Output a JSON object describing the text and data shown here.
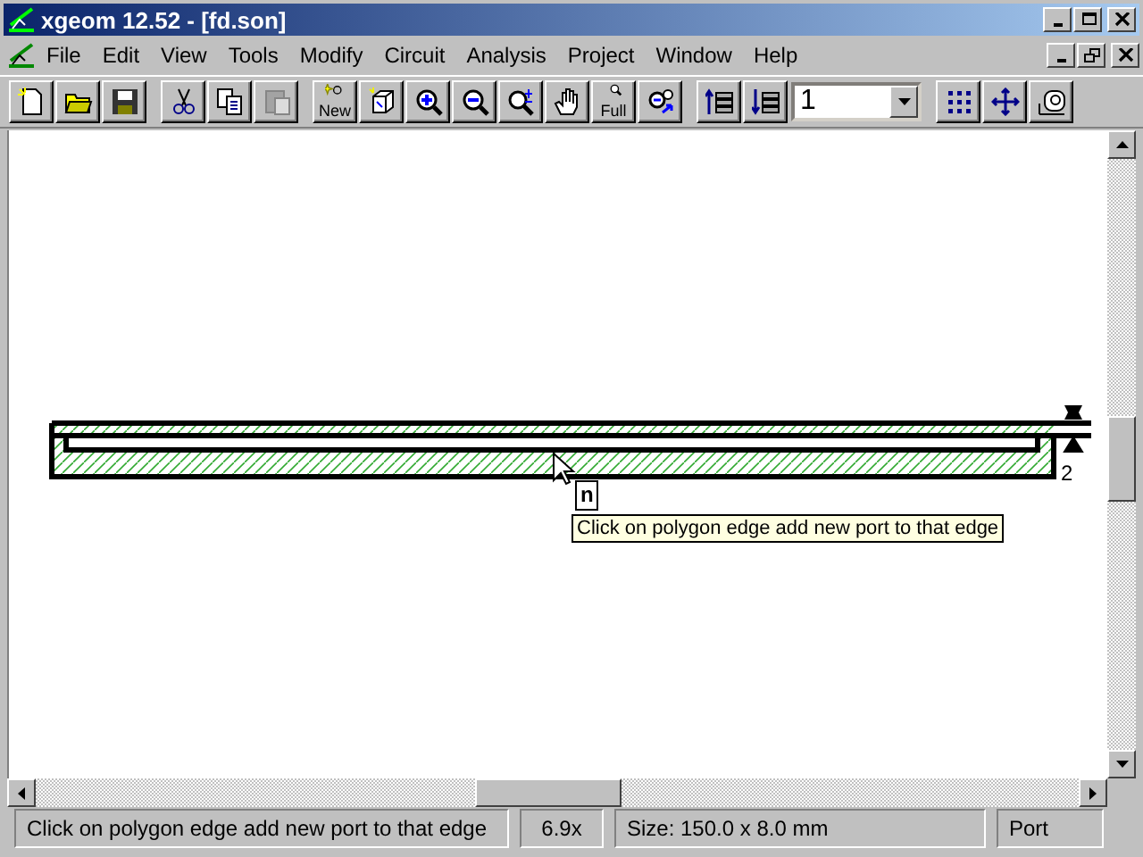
{
  "window": {
    "title": "xgeom 12.52 - [fd.son]"
  },
  "menu": [
    "File",
    "Edit",
    "View",
    "Tools",
    "Modify",
    "Circuit",
    "Analysis",
    "Project",
    "Window",
    "Help"
  ],
  "toolbar": {
    "groups": [
      [
        {
          "disabled": false
        },
        {
          "disabled": false
        },
        {
          "disabled": false
        }
      ],
      [
        {
          "disabled": false
        },
        {
          "disabled": false
        },
        {
          "disabled": true
        }
      ],
      [
        {
          "disabled": false,
          "label": "New"
        },
        {
          "disabled": false
        },
        {
          "disabled": false
        },
        {
          "disabled": false
        },
        {
          "disabled": false
        },
        {
          "disabled": false
        },
        {
          "disabled": false,
          "label": "Full"
        },
        {
          "disabled": false
        }
      ],
      [
        {
          "disabled": false
        },
        {
          "disabled": false
        }
      ],
      [
        {
          "disabled": false
        },
        {
          "disabled": false
        },
        {
          "disabled": false
        }
      ]
    ],
    "layer_combo": {
      "value": "1"
    }
  },
  "canvas": {
    "port_label": "2",
    "cursor_hint": "n",
    "tooltip": "Click on polygon edge add new port to that edge"
  },
  "status_bar": {
    "message": "Click on polygon edge add new port to that edge",
    "zoom": "6.9x",
    "size": "Size: 150.0 x 8.0 mm",
    "mode": "Port"
  }
}
